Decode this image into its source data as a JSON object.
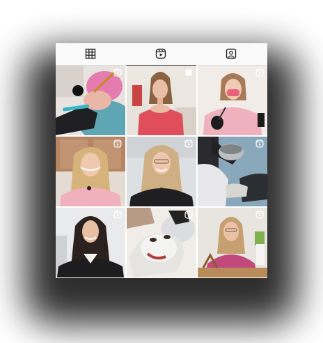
{
  "profile_tabs": [
    {
      "id": "posts",
      "icon": "grid-icon",
      "selected": false
    },
    {
      "id": "reels",
      "icon": "reels-icon",
      "selected": true
    },
    {
      "id": "tagged",
      "icon": "tagged-user-icon",
      "selected": false
    }
  ],
  "grid": {
    "items": [
      {
        "type": "reel",
        "icon": "reels-icon",
        "scene": "hand-tattoo-brush"
      },
      {
        "type": "reel",
        "icon": "reels-icon",
        "scene": "woman-red-top-brows"
      },
      {
        "type": "reel",
        "icon": "reels-icon",
        "scene": "woman-pink-mask-gloves"
      },
      {
        "type": "reel",
        "icon": "reels-icon",
        "scene": "woman-pink-blazer"
      },
      {
        "type": "reel",
        "icon": "reels-icon",
        "scene": "woman-black-top"
      },
      {
        "type": "reel",
        "icon": "reels-icon",
        "scene": "gloved-hand-bowl"
      },
      {
        "type": "reel",
        "icon": "reels-icon",
        "scene": "woman-black-blazer"
      },
      {
        "type": "reel",
        "icon": "reels-icon",
        "scene": "face-mask-treatment"
      },
      {
        "type": "reel",
        "icon": "reels-icon",
        "scene": "woman-pink-shirt-desk"
      }
    ]
  },
  "colors": {
    "tab_bar_bg": "#fafafa",
    "indicator": "#262626",
    "icon": "#262626"
  }
}
